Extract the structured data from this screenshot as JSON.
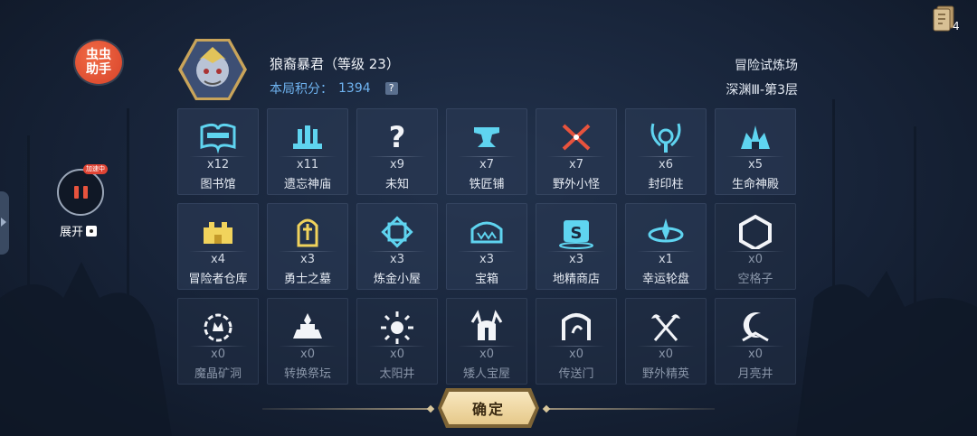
{
  "helper": {
    "line1": "虫虫",
    "line2": "助手",
    "speed_tag": "加速中",
    "expand_label": "展开"
  },
  "top_right": {
    "card_count": "4"
  },
  "header": {
    "boss_name": "狼裔暴君（等级 23）",
    "score_label": "本局积分：",
    "score_value": "1394",
    "help_glyph": "?",
    "mode_title": "冒险试炼场",
    "mode_sub": "深渊Ⅲ-第3层"
  },
  "colors": {
    "cyan_icon": "#5fd4f0",
    "yellow_icon": "#f1d35c",
    "white_icon": "#f2f4f8",
    "red_icon": "#e8533d",
    "accent_blue": "#6fb3f0"
  },
  "rooms": [
    {
      "name": "图书馆",
      "count": "x12",
      "icon": "book-icon",
      "color": "cyan"
    },
    {
      "name": "遗忘神庙",
      "count": "x11",
      "icon": "temple-pillars-icon",
      "color": "cyan"
    },
    {
      "name": "未知",
      "count": "x9",
      "icon": "question-icon",
      "color": "white"
    },
    {
      "name": "铁匠铺",
      "count": "x7",
      "icon": "anvil-icon",
      "color": "cyan"
    },
    {
      "name": "野外小怪",
      "count": "x7",
      "icon": "crossed-swords-icon",
      "color": "red"
    },
    {
      "name": "封印柱",
      "count": "x6",
      "icon": "seal-pillar-icon",
      "color": "cyan"
    },
    {
      "name": "生命神殿",
      "count": "x5",
      "icon": "life-shrine-icon",
      "color": "cyan"
    },
    {
      "name": "冒险者仓库",
      "count": "x4",
      "icon": "warehouse-icon",
      "color": "yellow"
    },
    {
      "name": "勇士之墓",
      "count": "x3",
      "icon": "tomb-icon",
      "color": "yellow"
    },
    {
      "name": "炼金小屋",
      "count": "x3",
      "icon": "alchemy-icon",
      "color": "cyan"
    },
    {
      "name": "宝箱",
      "count": "x3",
      "icon": "treasure-chest-icon",
      "color": "cyan"
    },
    {
      "name": "地精商店",
      "count": "x3",
      "icon": "goblin-shop-icon",
      "color": "cyan"
    },
    {
      "name": "幸运轮盘",
      "count": "x1",
      "icon": "lucky-wheel-icon",
      "color": "cyan"
    },
    {
      "name": "空格子",
      "count": "x0",
      "icon": "empty-hexagon-icon",
      "color": "white"
    },
    {
      "name": "魔晶矿洞",
      "count": "x0",
      "icon": "crystal-mine-icon",
      "color": "white"
    },
    {
      "name": "转换祭坛",
      "count": "x0",
      "icon": "altar-icon",
      "color": "white"
    },
    {
      "name": "太阳井",
      "count": "x0",
      "icon": "sun-well-icon",
      "color": "white"
    },
    {
      "name": "矮人宝屋",
      "count": "x0",
      "icon": "dwarf-helmet-icon",
      "color": "white"
    },
    {
      "name": "传送门",
      "count": "x0",
      "icon": "portal-icon",
      "color": "white"
    },
    {
      "name": "野外精英",
      "count": "x0",
      "icon": "crossed-axes-icon",
      "color": "white"
    },
    {
      "name": "月亮井",
      "count": "x0",
      "icon": "moon-well-icon",
      "color": "white"
    }
  ],
  "confirm": {
    "label": "确定"
  }
}
